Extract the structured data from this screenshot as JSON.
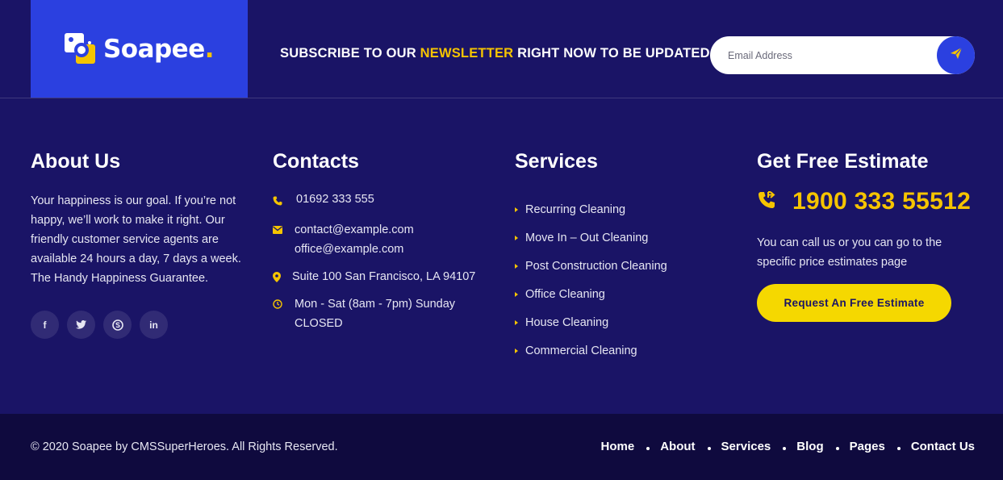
{
  "brand": {
    "name": "Soapee",
    "dot": "."
  },
  "newsletter": {
    "text_before": "SUBSCRIBE TO OUR ",
    "highlight": "NEWSLETTER",
    "text_after": " RIGHT NOW TO BE UPDATED.",
    "email_placeholder": "Email Address",
    "send_icon": "paper-plane-icon"
  },
  "about": {
    "title": "About Us",
    "text": "Your happiness is our goal. If you’re not happy, we’ll work to make it right. Our friendly customer service agents are available 24 hours a day, 7 days a week. The Handy Happiness Guarantee.",
    "socials": [
      {
        "icon": "facebook-icon",
        "glyph": "f"
      },
      {
        "icon": "twitter-icon",
        "glyph": "t"
      },
      {
        "icon": "skype-icon",
        "glyph": "s"
      },
      {
        "icon": "linkedin-icon",
        "glyph": "in"
      }
    ]
  },
  "contacts": {
    "title": "Contacts",
    "phone": "01692 333 555",
    "email_1": "contact@example.com",
    "email_2": "office@example.com",
    "address": "Suite 100 San Francisco, LA 94107",
    "hours_1": "Mon - Sat (8am - 7pm) Sunday",
    "hours_2": "CLOSED"
  },
  "services": {
    "title": "Services",
    "items": [
      "Recurring Cleaning",
      "Move In – Out Cleaning",
      "Post Construction Cleaning",
      "Office Cleaning",
      "House Cleaning",
      "Commercial Cleaning"
    ]
  },
  "estimate": {
    "title": "Get Free Estimate",
    "phone": "1900 333 55512",
    "text": "You can call us or you can go to the specific price estimates page",
    "button_label": "Request An Free Estimate"
  },
  "footer": {
    "copyright": "© 2020 Soapee by CMSSuperHeroes. All Rights Reserved.",
    "nav": [
      "Home",
      "About",
      "Services",
      "Blog",
      "Pages",
      "Contact Us"
    ]
  },
  "colors": {
    "background": "#1a1466",
    "bottom_bar": "#0f0a3e",
    "accent_blue": "#2b40e0",
    "accent_yellow": "#f5c400"
  }
}
